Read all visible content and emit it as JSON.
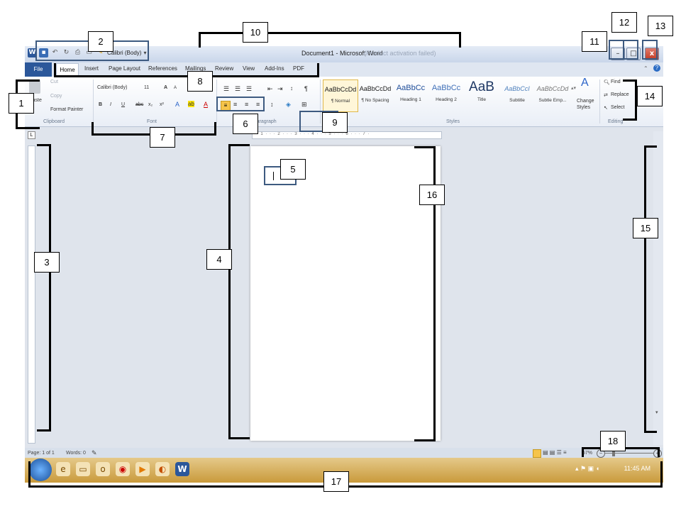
{
  "window": {
    "title": "Document1 - Microsoft Word",
    "title_faded": "(Product activation failed)",
    "quick_access": [
      "save-icon",
      "undo-icon",
      "redo-icon",
      "print-icon"
    ],
    "qat_font": "Calibri (Body)",
    "min_label": "–",
    "max_label": "□",
    "close_label": "x"
  },
  "tabs": {
    "file": "File",
    "items": [
      "Home",
      "Insert",
      "Page Layout",
      "References",
      "Mailings",
      "Review",
      "View",
      "Add-Ins",
      "PDF"
    ]
  },
  "ribbon": {
    "clipboard": {
      "paste": "Paste",
      "cut": "Cut",
      "copy": "Copy",
      "format_painter": "Format Painter",
      "label": "Clipboard"
    },
    "font": {
      "name": "Calibri (Body)",
      "size": "11",
      "label": "Font",
      "bold": "B",
      "italic": "I",
      "underline": "U",
      "strike": "abc",
      "sub": "x₂",
      "sup": "x²",
      "grow": "A",
      "shrink": "A"
    },
    "paragraph": {
      "label": "Paragraph"
    },
    "styles": {
      "label": "Styles",
      "items": [
        {
          "preview": "AaBbCcDd",
          "name": "¶ Normal"
        },
        {
          "preview": "AaBbCcDd",
          "name": "¶ No Spacing"
        },
        {
          "preview": "AaBbCc",
          "name": "Heading 1"
        },
        {
          "preview": "AaBbCc",
          "name": "Heading 2"
        },
        {
          "preview": "AaB",
          "name": "Title"
        },
        {
          "preview": "AaBbCcI",
          "name": "Subtitle"
        },
        {
          "preview": "AaBbCcDd",
          "name": "Subtle Emp..."
        }
      ],
      "change": "Change Styles"
    },
    "editing": {
      "find": "Find",
      "replace": "Replace",
      "select": "Select",
      "label": "Editing"
    }
  },
  "ruler": {
    "marks": "· · 1 · · · 2 · · · 3 · · · 4 · · · 5 · · · 6 · · · 7 ·"
  },
  "statusbar": {
    "page": "Page: 1 of 1",
    "words": "Words: 0",
    "zoom": "57%"
  },
  "taskbar": {
    "clock": "11:45 AM"
  },
  "annotations": [
    "1",
    "2",
    "3",
    "4",
    "5",
    "6",
    "7",
    "8",
    "9",
    "10",
    "11",
    "12",
    "13",
    "14",
    "15",
    "16",
    "17",
    "18"
  ],
  "colors": {
    "file_tab": "#2b579a",
    "close_button": "#c23a24",
    "taskbar": "#d8a94e",
    "annotation_blue": "#3d5a80"
  }
}
